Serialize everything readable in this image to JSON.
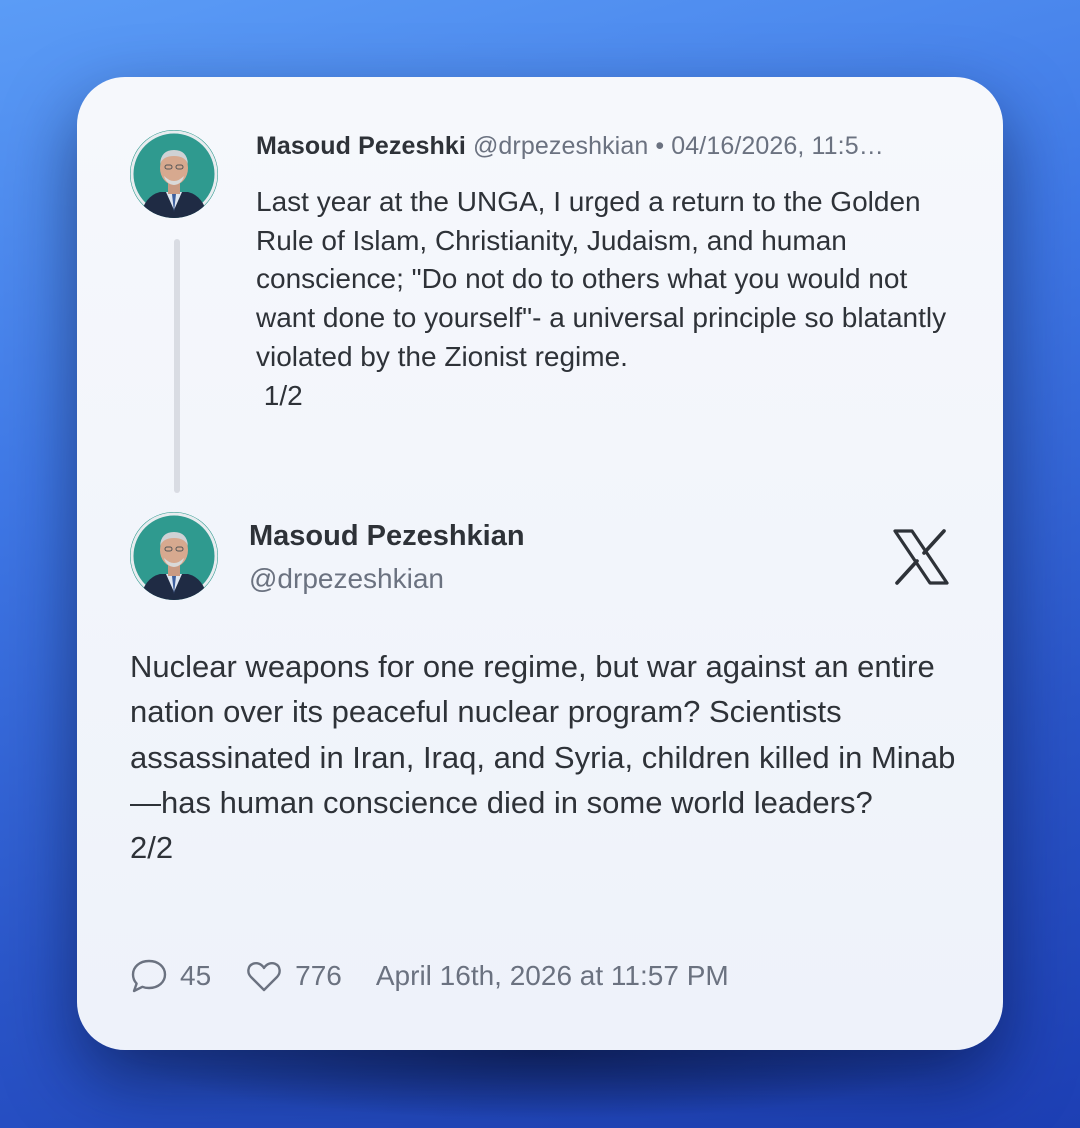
{
  "reply_tweet": {
    "name": "Masoud Pezeshki",
    "handle": "@drpezeshkian",
    "separator": "•",
    "date": "04/16/2026, 11:5…",
    "text": "Last year at the UNGA, I urged a return to the Golden Rule of Islam, Christianity, Judaism, and human conscience; \"Do not do to others what you would not want done to yourself\"- a universal principle so blatantly violated by the Zionist regime.\n 1/2"
  },
  "main_tweet": {
    "name": "Masoud Pezeshkian",
    "handle": "@drpezeshkian",
    "text": "Nuclear weapons for one regime, but war against an entire nation over its peaceful nuclear program? Scientists assassinated in Iran, Iraq, and Syria, children killed in Minab—has human conscience died in some world leaders?\n2/2"
  },
  "stats": {
    "replies": "45",
    "likes": "776",
    "timestamp": "April 16th, 2026 at 11:57 PM"
  },
  "icons": {
    "platform": "x-logo-icon",
    "reply": "speech-bubble-icon",
    "like": "heart-icon"
  },
  "colors": {
    "background_top": "#5b9cf6",
    "background_bottom": "#1d3fb4",
    "card": "#f3f6fb",
    "text_primary": "#2e3238",
    "text_secondary": "#6b7280"
  }
}
